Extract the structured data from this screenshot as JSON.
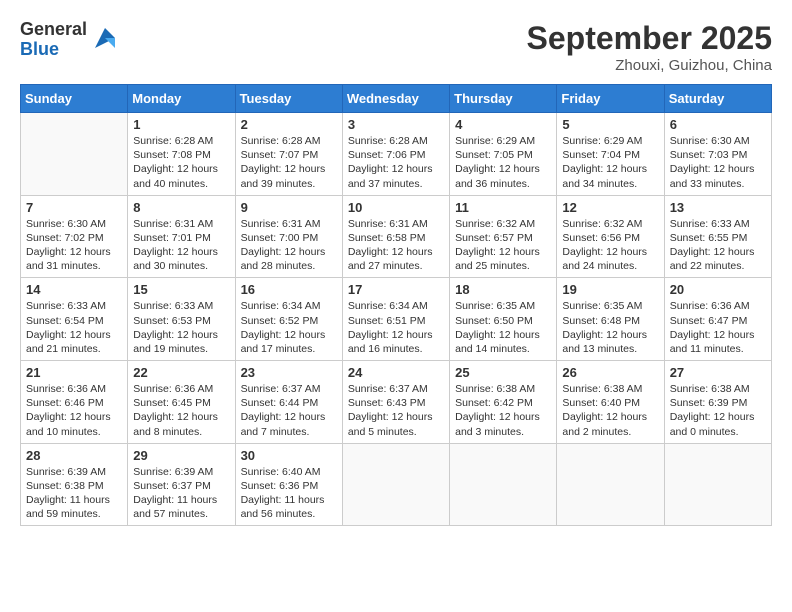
{
  "logo": {
    "general": "General",
    "blue": "Blue"
  },
  "title": "September 2025",
  "location": "Zhouxi, Guizhou, China",
  "days_of_week": [
    "Sunday",
    "Monday",
    "Tuesday",
    "Wednesday",
    "Thursday",
    "Friday",
    "Saturday"
  ],
  "weeks": [
    [
      {
        "day": "",
        "info": ""
      },
      {
        "day": "1",
        "info": "Sunrise: 6:28 AM\nSunset: 7:08 PM\nDaylight: 12 hours\nand 40 minutes."
      },
      {
        "day": "2",
        "info": "Sunrise: 6:28 AM\nSunset: 7:07 PM\nDaylight: 12 hours\nand 39 minutes."
      },
      {
        "day": "3",
        "info": "Sunrise: 6:28 AM\nSunset: 7:06 PM\nDaylight: 12 hours\nand 37 minutes."
      },
      {
        "day": "4",
        "info": "Sunrise: 6:29 AM\nSunset: 7:05 PM\nDaylight: 12 hours\nand 36 minutes."
      },
      {
        "day": "5",
        "info": "Sunrise: 6:29 AM\nSunset: 7:04 PM\nDaylight: 12 hours\nand 34 minutes."
      },
      {
        "day": "6",
        "info": "Sunrise: 6:30 AM\nSunset: 7:03 PM\nDaylight: 12 hours\nand 33 minutes."
      }
    ],
    [
      {
        "day": "7",
        "info": "Sunrise: 6:30 AM\nSunset: 7:02 PM\nDaylight: 12 hours\nand 31 minutes."
      },
      {
        "day": "8",
        "info": "Sunrise: 6:31 AM\nSunset: 7:01 PM\nDaylight: 12 hours\nand 30 minutes."
      },
      {
        "day": "9",
        "info": "Sunrise: 6:31 AM\nSunset: 7:00 PM\nDaylight: 12 hours\nand 28 minutes."
      },
      {
        "day": "10",
        "info": "Sunrise: 6:31 AM\nSunset: 6:58 PM\nDaylight: 12 hours\nand 27 minutes."
      },
      {
        "day": "11",
        "info": "Sunrise: 6:32 AM\nSunset: 6:57 PM\nDaylight: 12 hours\nand 25 minutes."
      },
      {
        "day": "12",
        "info": "Sunrise: 6:32 AM\nSunset: 6:56 PM\nDaylight: 12 hours\nand 24 minutes."
      },
      {
        "day": "13",
        "info": "Sunrise: 6:33 AM\nSunset: 6:55 PM\nDaylight: 12 hours\nand 22 minutes."
      }
    ],
    [
      {
        "day": "14",
        "info": "Sunrise: 6:33 AM\nSunset: 6:54 PM\nDaylight: 12 hours\nand 21 minutes."
      },
      {
        "day": "15",
        "info": "Sunrise: 6:33 AM\nSunset: 6:53 PM\nDaylight: 12 hours\nand 19 minutes."
      },
      {
        "day": "16",
        "info": "Sunrise: 6:34 AM\nSunset: 6:52 PM\nDaylight: 12 hours\nand 17 minutes."
      },
      {
        "day": "17",
        "info": "Sunrise: 6:34 AM\nSunset: 6:51 PM\nDaylight: 12 hours\nand 16 minutes."
      },
      {
        "day": "18",
        "info": "Sunrise: 6:35 AM\nSunset: 6:50 PM\nDaylight: 12 hours\nand 14 minutes."
      },
      {
        "day": "19",
        "info": "Sunrise: 6:35 AM\nSunset: 6:48 PM\nDaylight: 12 hours\nand 13 minutes."
      },
      {
        "day": "20",
        "info": "Sunrise: 6:36 AM\nSunset: 6:47 PM\nDaylight: 12 hours\nand 11 minutes."
      }
    ],
    [
      {
        "day": "21",
        "info": "Sunrise: 6:36 AM\nSunset: 6:46 PM\nDaylight: 12 hours\nand 10 minutes."
      },
      {
        "day": "22",
        "info": "Sunrise: 6:36 AM\nSunset: 6:45 PM\nDaylight: 12 hours\nand 8 minutes."
      },
      {
        "day": "23",
        "info": "Sunrise: 6:37 AM\nSunset: 6:44 PM\nDaylight: 12 hours\nand 7 minutes."
      },
      {
        "day": "24",
        "info": "Sunrise: 6:37 AM\nSunset: 6:43 PM\nDaylight: 12 hours\nand 5 minutes."
      },
      {
        "day": "25",
        "info": "Sunrise: 6:38 AM\nSunset: 6:42 PM\nDaylight: 12 hours\nand 3 minutes."
      },
      {
        "day": "26",
        "info": "Sunrise: 6:38 AM\nSunset: 6:40 PM\nDaylight: 12 hours\nand 2 minutes."
      },
      {
        "day": "27",
        "info": "Sunrise: 6:38 AM\nSunset: 6:39 PM\nDaylight: 12 hours\nand 0 minutes."
      }
    ],
    [
      {
        "day": "28",
        "info": "Sunrise: 6:39 AM\nSunset: 6:38 PM\nDaylight: 11 hours\nand 59 minutes."
      },
      {
        "day": "29",
        "info": "Sunrise: 6:39 AM\nSunset: 6:37 PM\nDaylight: 11 hours\nand 57 minutes."
      },
      {
        "day": "30",
        "info": "Sunrise: 6:40 AM\nSunset: 6:36 PM\nDaylight: 11 hours\nand 56 minutes."
      },
      {
        "day": "",
        "info": ""
      },
      {
        "day": "",
        "info": ""
      },
      {
        "day": "",
        "info": ""
      },
      {
        "day": "",
        "info": ""
      }
    ]
  ]
}
